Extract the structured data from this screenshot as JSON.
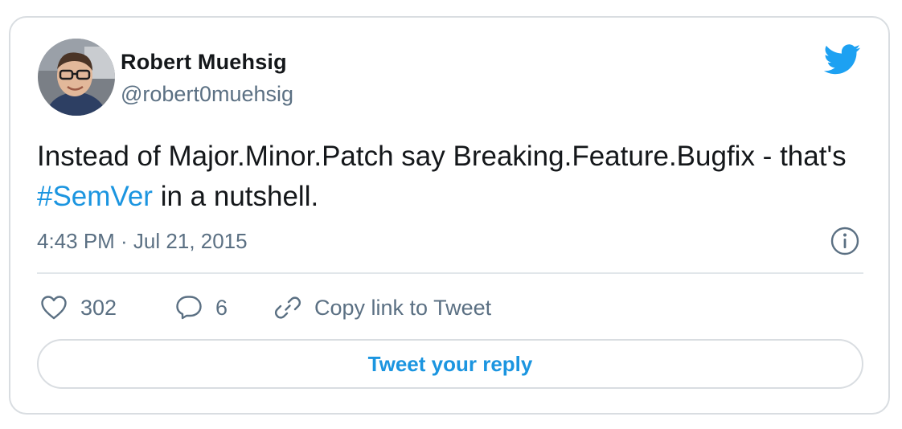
{
  "author": {
    "display_name": "Robert Muehsig",
    "handle": "@robert0muehsig"
  },
  "tweet": {
    "text_before": "Instead of Major.Minor.Patch say Breaking.Feature.Bugfix - that's ",
    "hashtag": "#SemVer",
    "text_after": " in a nutshell.",
    "timestamp": "4:43 PM · Jul 21, 2015"
  },
  "actions": {
    "like_count": "302",
    "reply_count": "6",
    "copy_link_label": "Copy link to Tweet"
  },
  "reply_button": {
    "label": "Tweet your reply"
  },
  "colors": {
    "brand": "#1da1f2",
    "link": "#1b95e0",
    "muted": "#5b7083",
    "text": "#14171a",
    "border": "#d9dde1"
  },
  "icons": [
    "twitter-bird-icon",
    "info-icon",
    "heart-icon",
    "reply-bubble-icon",
    "link-icon"
  ]
}
